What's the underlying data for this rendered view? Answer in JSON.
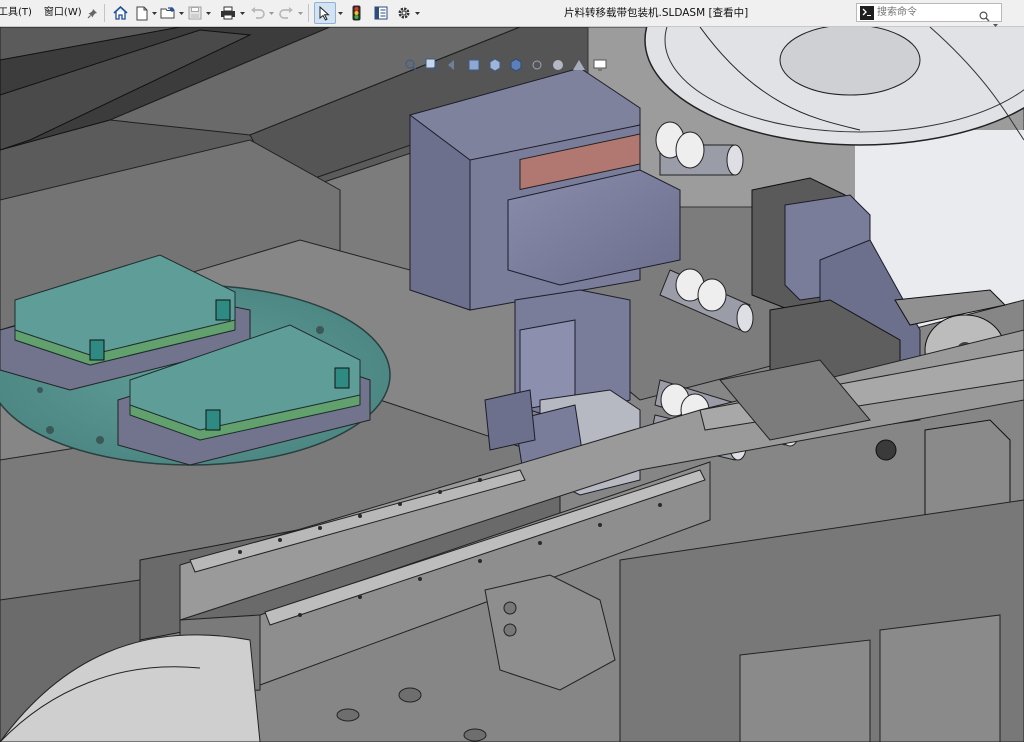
{
  "menubar": {
    "tools_label": "工具(T)",
    "window_label": "窗口(W)"
  },
  "document": {
    "title": "片料转移载带包装机.SLDASM [查看中]"
  },
  "search": {
    "placeholder": "搜索命令"
  },
  "icons": {
    "pin": "pin-icon",
    "home": "home-icon",
    "new": "new-document-icon",
    "open": "open-folder-icon",
    "save": "save-icon",
    "print": "print-icon",
    "undo": "undo-icon",
    "redo": "redo-icon",
    "select": "select-pointer-icon",
    "rebuild": "traffic-light-icon",
    "file_properties": "file-properties-icon",
    "options": "gear-icon",
    "search": "magnifier-icon",
    "command": "command-prompt-icon"
  },
  "colors": {
    "toolbar_bg": "#f0f0f0",
    "select_highlight": "#d3e3f3",
    "model_blue_gray": "#7a7d9a",
    "model_teal": "#4f8a86",
    "model_green": "#5d9e72",
    "frame_gray": "#8a8a8a"
  }
}
